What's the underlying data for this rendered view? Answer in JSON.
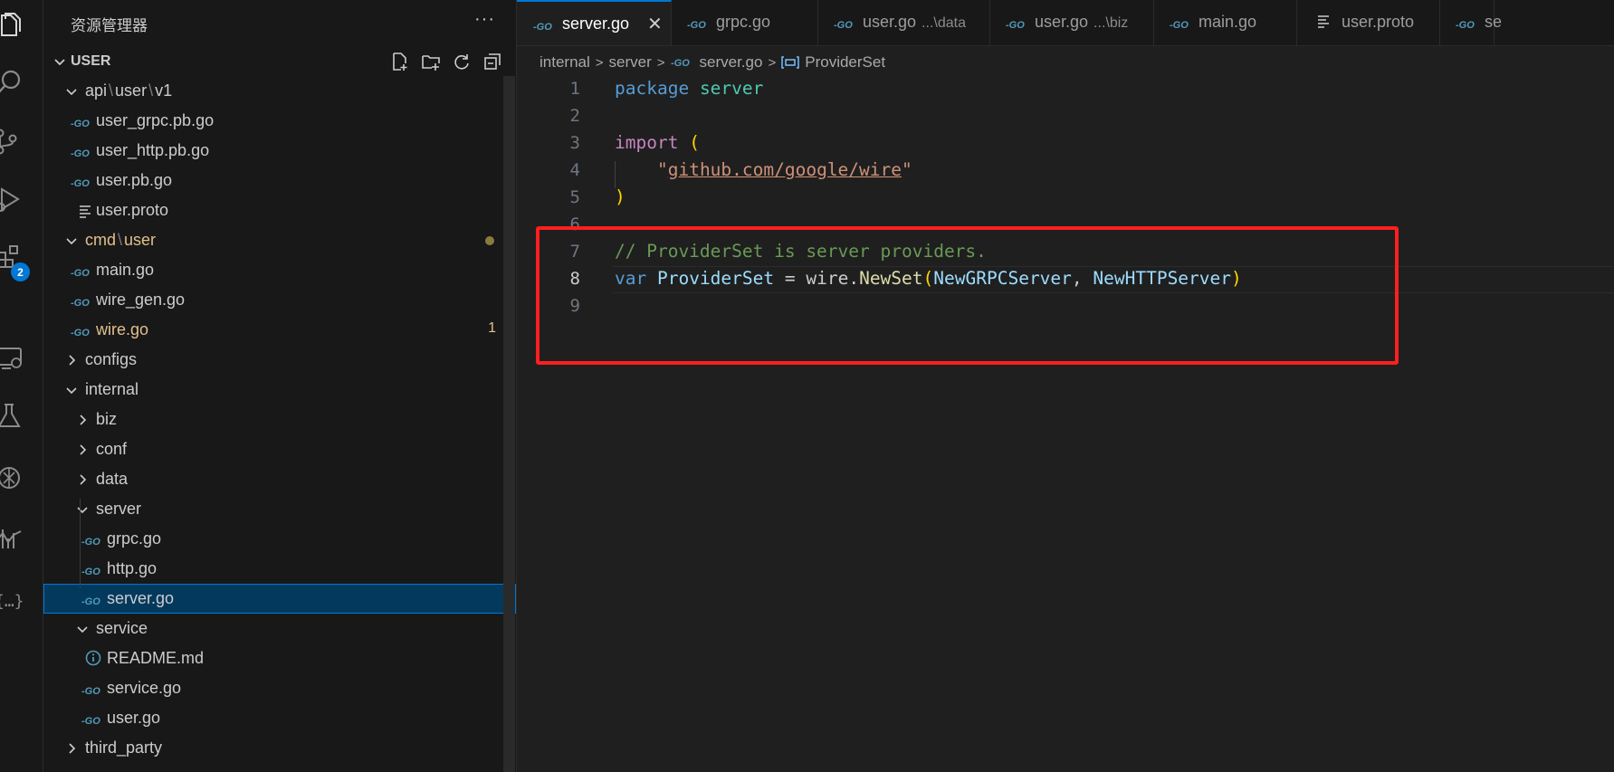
{
  "explorer": {
    "title": "资源管理器",
    "more_label": "···",
    "section_label": "USER",
    "tree": [
      {
        "label_parts": [
          "api",
          "user",
          "v1"
        ],
        "kind": "folder"
      },
      {
        "label": "user_grpc.pb.go",
        "kind": "go"
      },
      {
        "label": "user_http.pb.go",
        "kind": "go"
      },
      {
        "label": "user.pb.go",
        "kind": "go"
      },
      {
        "label": "user.proto",
        "kind": "proto"
      },
      {
        "label_parts": [
          "cmd",
          "user"
        ],
        "kind": "folder",
        "status": "modified"
      },
      {
        "label": "main.go",
        "kind": "go"
      },
      {
        "label": "wire_gen.go",
        "kind": "go"
      },
      {
        "label": "wire.go",
        "kind": "go",
        "status": "modified",
        "badge": "1"
      },
      {
        "label": "configs",
        "kind": "folder"
      },
      {
        "label": "internal",
        "kind": "folder"
      },
      {
        "label": "biz",
        "kind": "folder"
      },
      {
        "label": "conf",
        "kind": "folder"
      },
      {
        "label": "data",
        "kind": "folder"
      },
      {
        "label": "server",
        "kind": "folder"
      },
      {
        "label": "grpc.go",
        "kind": "go"
      },
      {
        "label": "http.go",
        "kind": "go"
      },
      {
        "label": "server.go",
        "kind": "go",
        "selected": true
      },
      {
        "label": "service",
        "kind": "folder"
      },
      {
        "label": "README.md",
        "kind": "info"
      },
      {
        "label": "service.go",
        "kind": "go"
      },
      {
        "label": "user.go",
        "kind": "go"
      },
      {
        "label": "third_party",
        "kind": "folder"
      }
    ]
  },
  "activity": {
    "extensions_badge": "2"
  },
  "tabs": [
    {
      "label": "server.go",
      "active": true,
      "close": "✕"
    },
    {
      "label": "grpc.go"
    },
    {
      "label": "user.go",
      "desc": "...\\data"
    },
    {
      "label": "user.go",
      "desc": "...\\biz"
    },
    {
      "label": "main.go"
    },
    {
      "label": "user.proto"
    },
    {
      "label": "se"
    }
  ],
  "breadcrumb": {
    "parts": [
      "internal",
      "server",
      "server.go",
      "ProviderSet"
    ],
    "sep": ">"
  },
  "editor": {
    "line_numbers": [
      "1",
      "2",
      "3",
      "4",
      "5",
      "6",
      "7",
      "8",
      "9"
    ],
    "current_line": "8",
    "lines": {
      "l1_kw": "package",
      "l1_pkg": "server",
      "l3_kw": "import",
      "l3_paren": "(",
      "l4_q1": "\"",
      "l4_path": "github.com/google/wire",
      "l4_q2": "\"",
      "l5_paren": ")",
      "l7_comment": "// ProviderSet is server providers.",
      "l8_kw": "var",
      "l8_var": "ProviderSet",
      "l8_eq": " = ",
      "l8_pkg": "wire",
      "l8_dot": ".",
      "l8_fn": "NewSet",
      "l8_open": "(",
      "l8_arg1": "NewGRPCServer",
      "l8_comma": ", ",
      "l8_arg2": "NewHTTPServer",
      "l8_close": ")"
    }
  },
  "colors": {
    "highlight_box": "#ff1f1f",
    "accent": "#0078d4",
    "modified": "#e2c08d",
    "go_icon": "#519aba"
  }
}
